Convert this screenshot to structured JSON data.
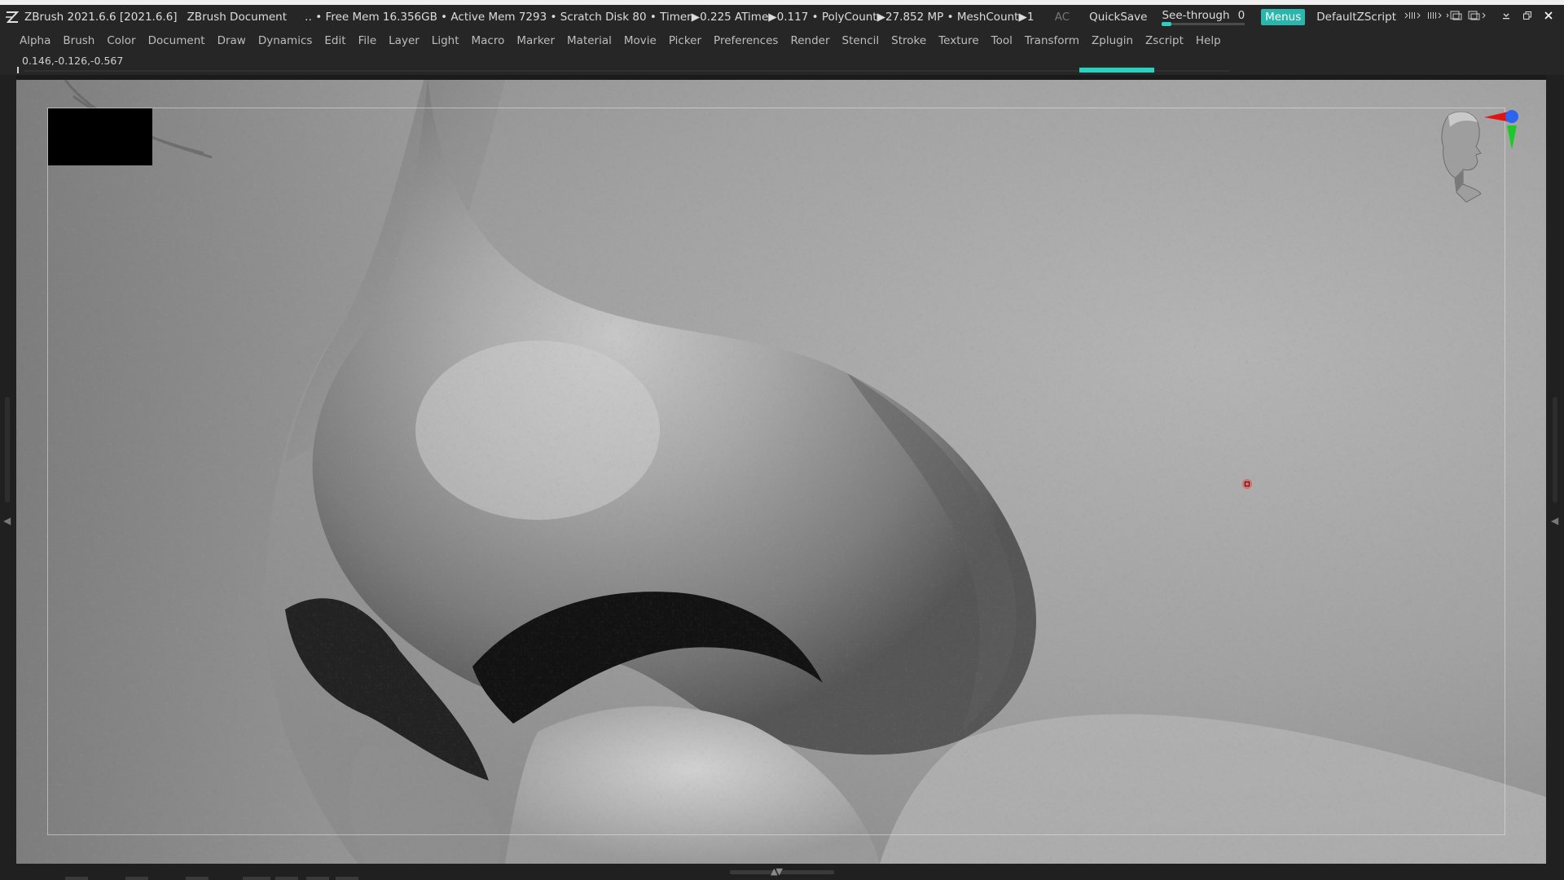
{
  "titlebar": {
    "app_title": "ZBrush 2021.6.6 [2021.6.6]",
    "document": "ZBrush Document",
    "status": "‥ • Free Mem 16.356GB • Active Mem 7293 • Scratch Disk 80 •  Timer▶0.225 ATime▶0.117 • PolyCount▶27.852 MP  • MeshCount▶1",
    "ac_label": "AC",
    "quicksave_label": "QuickSave",
    "seethrough_label": "See-through",
    "seethrough_value": "0",
    "menus_label": "Menus",
    "script_label": "DefaultZScript",
    "accent_color": "#26d4c4"
  },
  "menubar": {
    "items": [
      "Alpha",
      "Brush",
      "Color",
      "Document",
      "Draw",
      "Dynamics",
      "Edit",
      "File",
      "Layer",
      "Light",
      "Macro",
      "Marker",
      "Material",
      "Movie",
      "Picker",
      "Preferences",
      "Render",
      "Stencil",
      "Stroke",
      "Texture",
      "Tool",
      "Transform",
      "Zplugin",
      "Zscript",
      "Help"
    ]
  },
  "coordinates": "0.146,-0.126,-0.567",
  "icons": {
    "logo": "zbrush-logo-icon",
    "minimize": "minimize-icon",
    "restore": "restore-icon",
    "close": "close-icon",
    "gizmo": "head-navigation-gizmo-icon"
  }
}
